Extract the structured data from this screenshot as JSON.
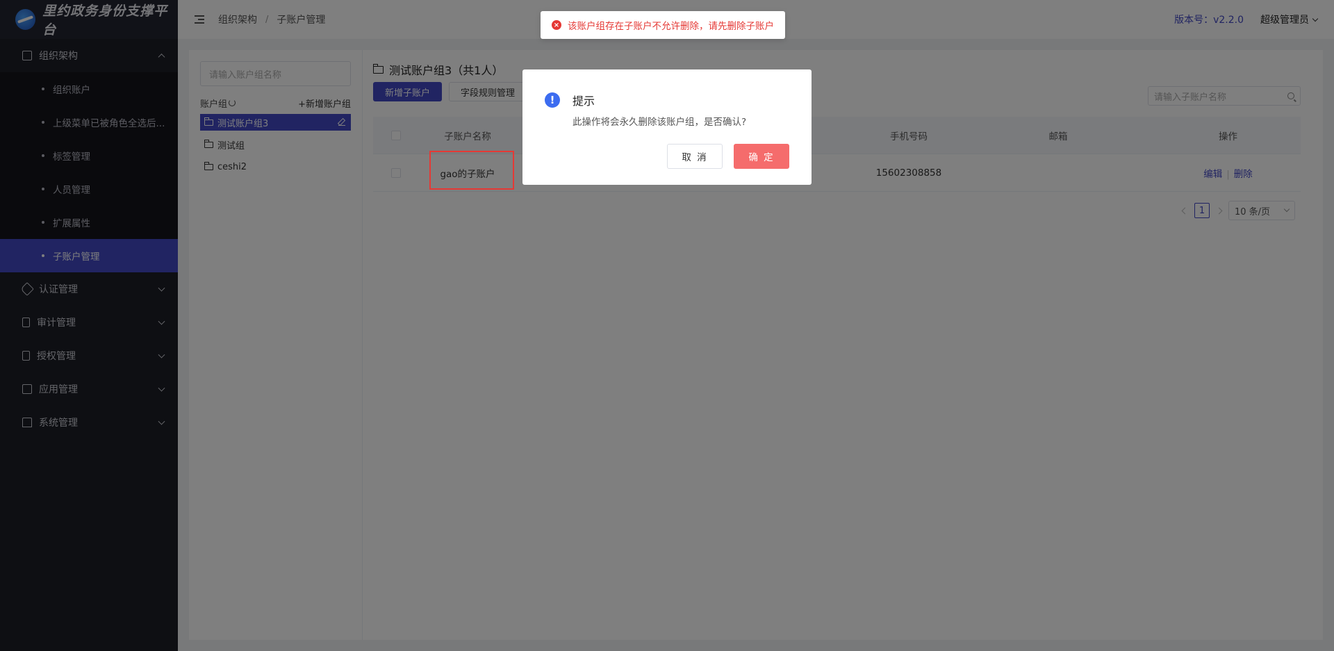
{
  "app": {
    "title": "里约政务身份支撑平台"
  },
  "sidebar": {
    "groups": [
      {
        "label": "组织架构",
        "icon": "org-icon",
        "expanded": true,
        "items": [
          {
            "label": "组织账户"
          },
          {
            "label": "上级菜单已被角色全选后..."
          },
          {
            "label": "标签管理"
          },
          {
            "label": "人员管理"
          },
          {
            "label": "扩展属性"
          },
          {
            "label": "子账户管理",
            "active": true
          }
        ]
      },
      {
        "label": "认证管理",
        "icon": "tag-icon"
      },
      {
        "label": "审计管理",
        "icon": "doc-icon"
      },
      {
        "label": "授权管理",
        "icon": "file-icon"
      },
      {
        "label": "应用管理",
        "icon": "app-icon"
      },
      {
        "label": "系统管理",
        "icon": "home-icon"
      }
    ]
  },
  "header": {
    "breadcrumb": [
      "组织架构",
      "子账户管理"
    ],
    "separator": "/",
    "version": "版本号：v2.2.0",
    "user": "超级管理员"
  },
  "left_panel": {
    "search_placeholder": "请输入账户组名称",
    "group_label": "账户组",
    "add_group": "+新增账户组",
    "groups": [
      {
        "label": "测试账户组3",
        "selected": true
      },
      {
        "label": "测试组"
      },
      {
        "label": "ceshi2"
      }
    ]
  },
  "right_panel": {
    "title": "测试账户组3（共1人）",
    "add_button": "新增子账户",
    "field_rule_button": "字段规则管理",
    "search_placeholder": "请输入子账户名称",
    "columns": [
      "子账户名称",
      "手机号码",
      "邮箱",
      "操作"
    ],
    "rows": [
      {
        "name": "gao的子账户",
        "phone": "15602308858",
        "email": "",
        "edit": "编辑",
        "delete": "删除"
      }
    ],
    "pagination": {
      "current": "1",
      "page_size": "10 条/页"
    }
  },
  "toast": {
    "message": "该账户组存在子账户不允许删除，请先删除子账户",
    "color": "#e53935"
  },
  "dialog": {
    "title": "提示",
    "message": "此操作将会永久删除该账户组，是否确认?",
    "cancel": "取 消",
    "confirm": "确 定"
  },
  "colors": {
    "primary": "#4349c5",
    "danger": "#f56c6c",
    "sidebar": "#1d1e26"
  }
}
